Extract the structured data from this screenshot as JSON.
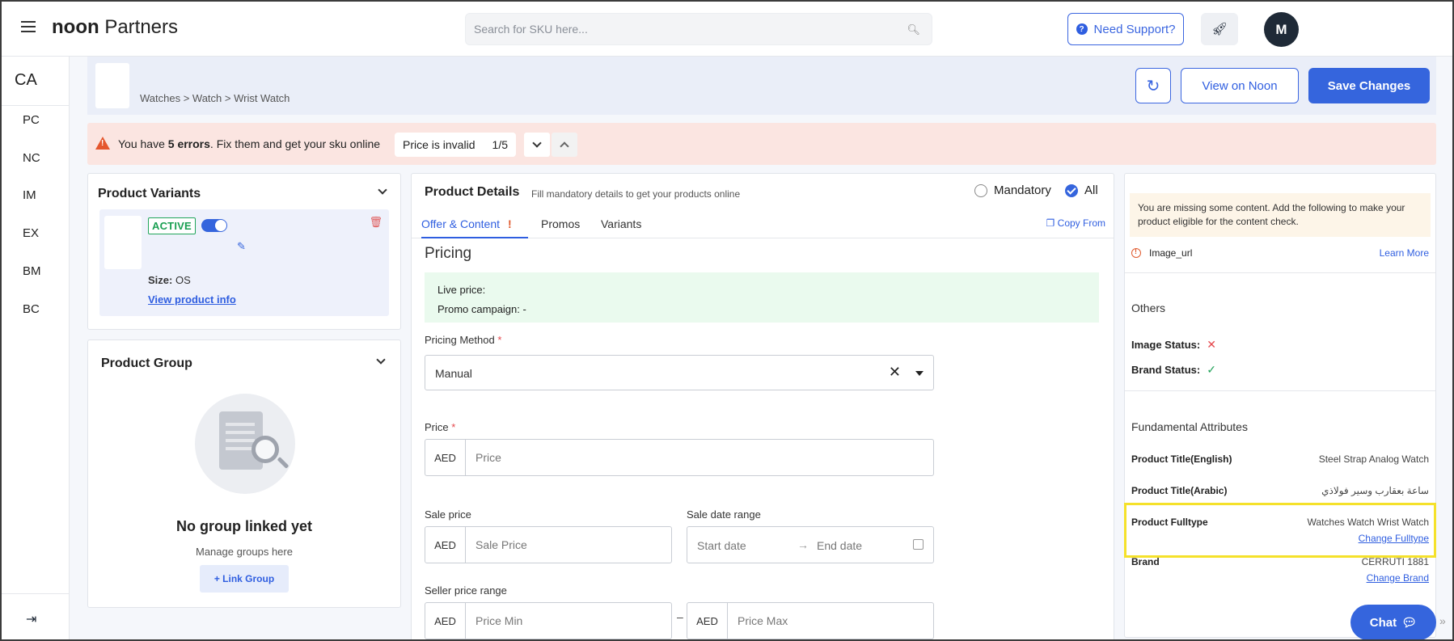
{
  "header": {
    "logo_bold": "noon",
    "logo_light": "Partners",
    "search_placeholder": "Search for SKU here...",
    "support_label": "Need Support?",
    "avatar_initial": "M"
  },
  "rail": {
    "top_label": "CA",
    "items": [
      "PC",
      "NC",
      "IM",
      "EX",
      "BM",
      "BC"
    ]
  },
  "breadcrumb": {
    "path": "Watches > Watch > Wrist Watch",
    "view_label": "View on Noon",
    "save_label": "Save Changes"
  },
  "errors": {
    "prefix": "You have ",
    "count_text": "5 errors",
    "suffix": ". Fix them and get your sku online",
    "current_error": "Price is invalid",
    "position": "1/5"
  },
  "variants": {
    "title": "Product Variants",
    "status": "ACTIVE",
    "size_label": "Size:",
    "size_value": "OS",
    "view_info": "View product info"
  },
  "group": {
    "title": "Product Group",
    "empty_title": "No group linked yet",
    "empty_sub": "Manage groups here",
    "link_label": "+ Link Group"
  },
  "details": {
    "title": "Product Details",
    "subtitle": "Fill mandatory details to get your products online",
    "filter_mandatory": "Mandatory",
    "filter_all": "All",
    "tabs": [
      "Offer & Content",
      "Promos",
      "Variants"
    ],
    "tab_alert": "!",
    "copy_from": "Copy From",
    "pricing_heading": "Pricing",
    "live_price": "Live price:",
    "promo_campaign": "Promo campaign: -",
    "pricing_method_label": "Pricing Method",
    "pricing_method_value": "Manual",
    "price_label": "Price",
    "currency": "AED",
    "price_placeholder": "Price",
    "sale_price_label": "Sale price",
    "sale_price_placeholder": "Sale Price",
    "sale_date_label": "Sale date range",
    "start_date": "Start date",
    "end_date": "End date",
    "seller_range_label": "Seller price range",
    "price_min_placeholder": "Price Min",
    "price_max_placeholder": "Price Max",
    "range_dash": "–"
  },
  "right": {
    "notice": "You are missing some content. Add the following to make your product eligible for the content check.",
    "missing_field": "Image_url",
    "learn_more": "Learn More",
    "others_heading": "Others",
    "image_status_label": "Image Status:",
    "brand_status_label": "Brand Status:",
    "fundamental_heading": "Fundamental Attributes",
    "attributes": [
      {
        "key": "Product Title(English)",
        "value": "Steel Strap Analog Watch"
      },
      {
        "key": "Product Title(Arabic)",
        "value": "ساعة بعقارب وسير فولاذي"
      },
      {
        "key": "Product Fulltype",
        "value": "Watches Watch Wrist Watch",
        "link": "Change Fulltype"
      },
      {
        "key": "Brand",
        "value": "CERRUTI 1881",
        "link": "Change Brand"
      }
    ],
    "chat_label": "Chat"
  },
  "colors": {
    "primary": "#3565dd",
    "error_bg": "#fbe5e1",
    "success": "#22a35a",
    "highlight": "#f5e12a"
  }
}
